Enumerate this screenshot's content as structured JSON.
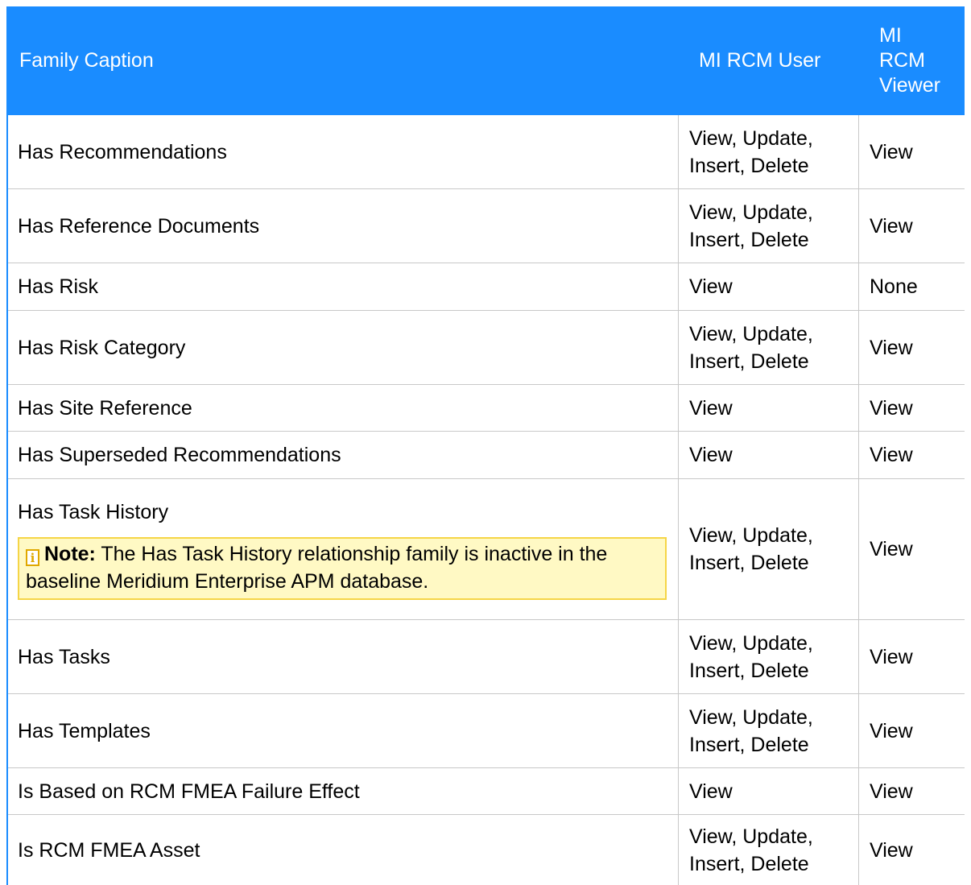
{
  "header": {
    "family_caption": "Family Caption",
    "mi_rcm_user": "MI RCM User",
    "mi_rcm_viewer_line1": "MI",
    "mi_rcm_viewer_line2": "RCM",
    "mi_rcm_viewer_line3": "Viewer"
  },
  "rows": [
    {
      "caption": "Has Recommendations",
      "user_l1": "View, Update,",
      "user_l2": "Insert, Delete",
      "viewer": "View"
    },
    {
      "caption": "Has Reference Documents",
      "user_l1": "View, Update,",
      "user_l2": "Insert, Delete",
      "viewer": "View"
    },
    {
      "caption": "Has Risk",
      "user_l1": "View",
      "user_l2": "",
      "viewer": "None"
    },
    {
      "caption": "Has Risk Category",
      "user_l1": "View, Update,",
      "user_l2": "Insert, Delete",
      "viewer": "View"
    },
    {
      "caption": "Has Site Reference",
      "user_l1": "View",
      "user_l2": "",
      "viewer": "View"
    },
    {
      "caption": "Has Superseded Recommendations",
      "user_l1": "View",
      "user_l2": "",
      "viewer": "View"
    },
    {
      "caption": "Has Task History",
      "user_l1": "View, Update,",
      "user_l2": "Insert, Delete",
      "viewer": "View",
      "note_label": "Note:",
      "note_text": " The Has Task History relationship family is inactive in the baseline Meridium Enterprise APM database."
    },
    {
      "caption": "Has Tasks",
      "user_l1": "View, Update,",
      "user_l2": "Insert, Delete",
      "viewer": "View"
    },
    {
      "caption": "Has Templates",
      "user_l1": "View, Update,",
      "user_l2": "Insert, Delete",
      "viewer": "View"
    },
    {
      "caption": "Is Based on RCM FMEA Failure Effect",
      "user_l1": "View",
      "user_l2": "",
      "viewer": "View"
    },
    {
      "caption": "Is RCM FMEA Asset",
      "user_l1": "View, Update,",
      "user_l2": "Insert, Delete",
      "viewer": "View"
    }
  ],
  "colors": {
    "header_bg": "#1a8cff",
    "grid_line": "#c8c8c8",
    "note_bg": "#fff9c4",
    "note_border": "#f5d547"
  },
  "icons": {
    "note": "info-note-icon"
  }
}
